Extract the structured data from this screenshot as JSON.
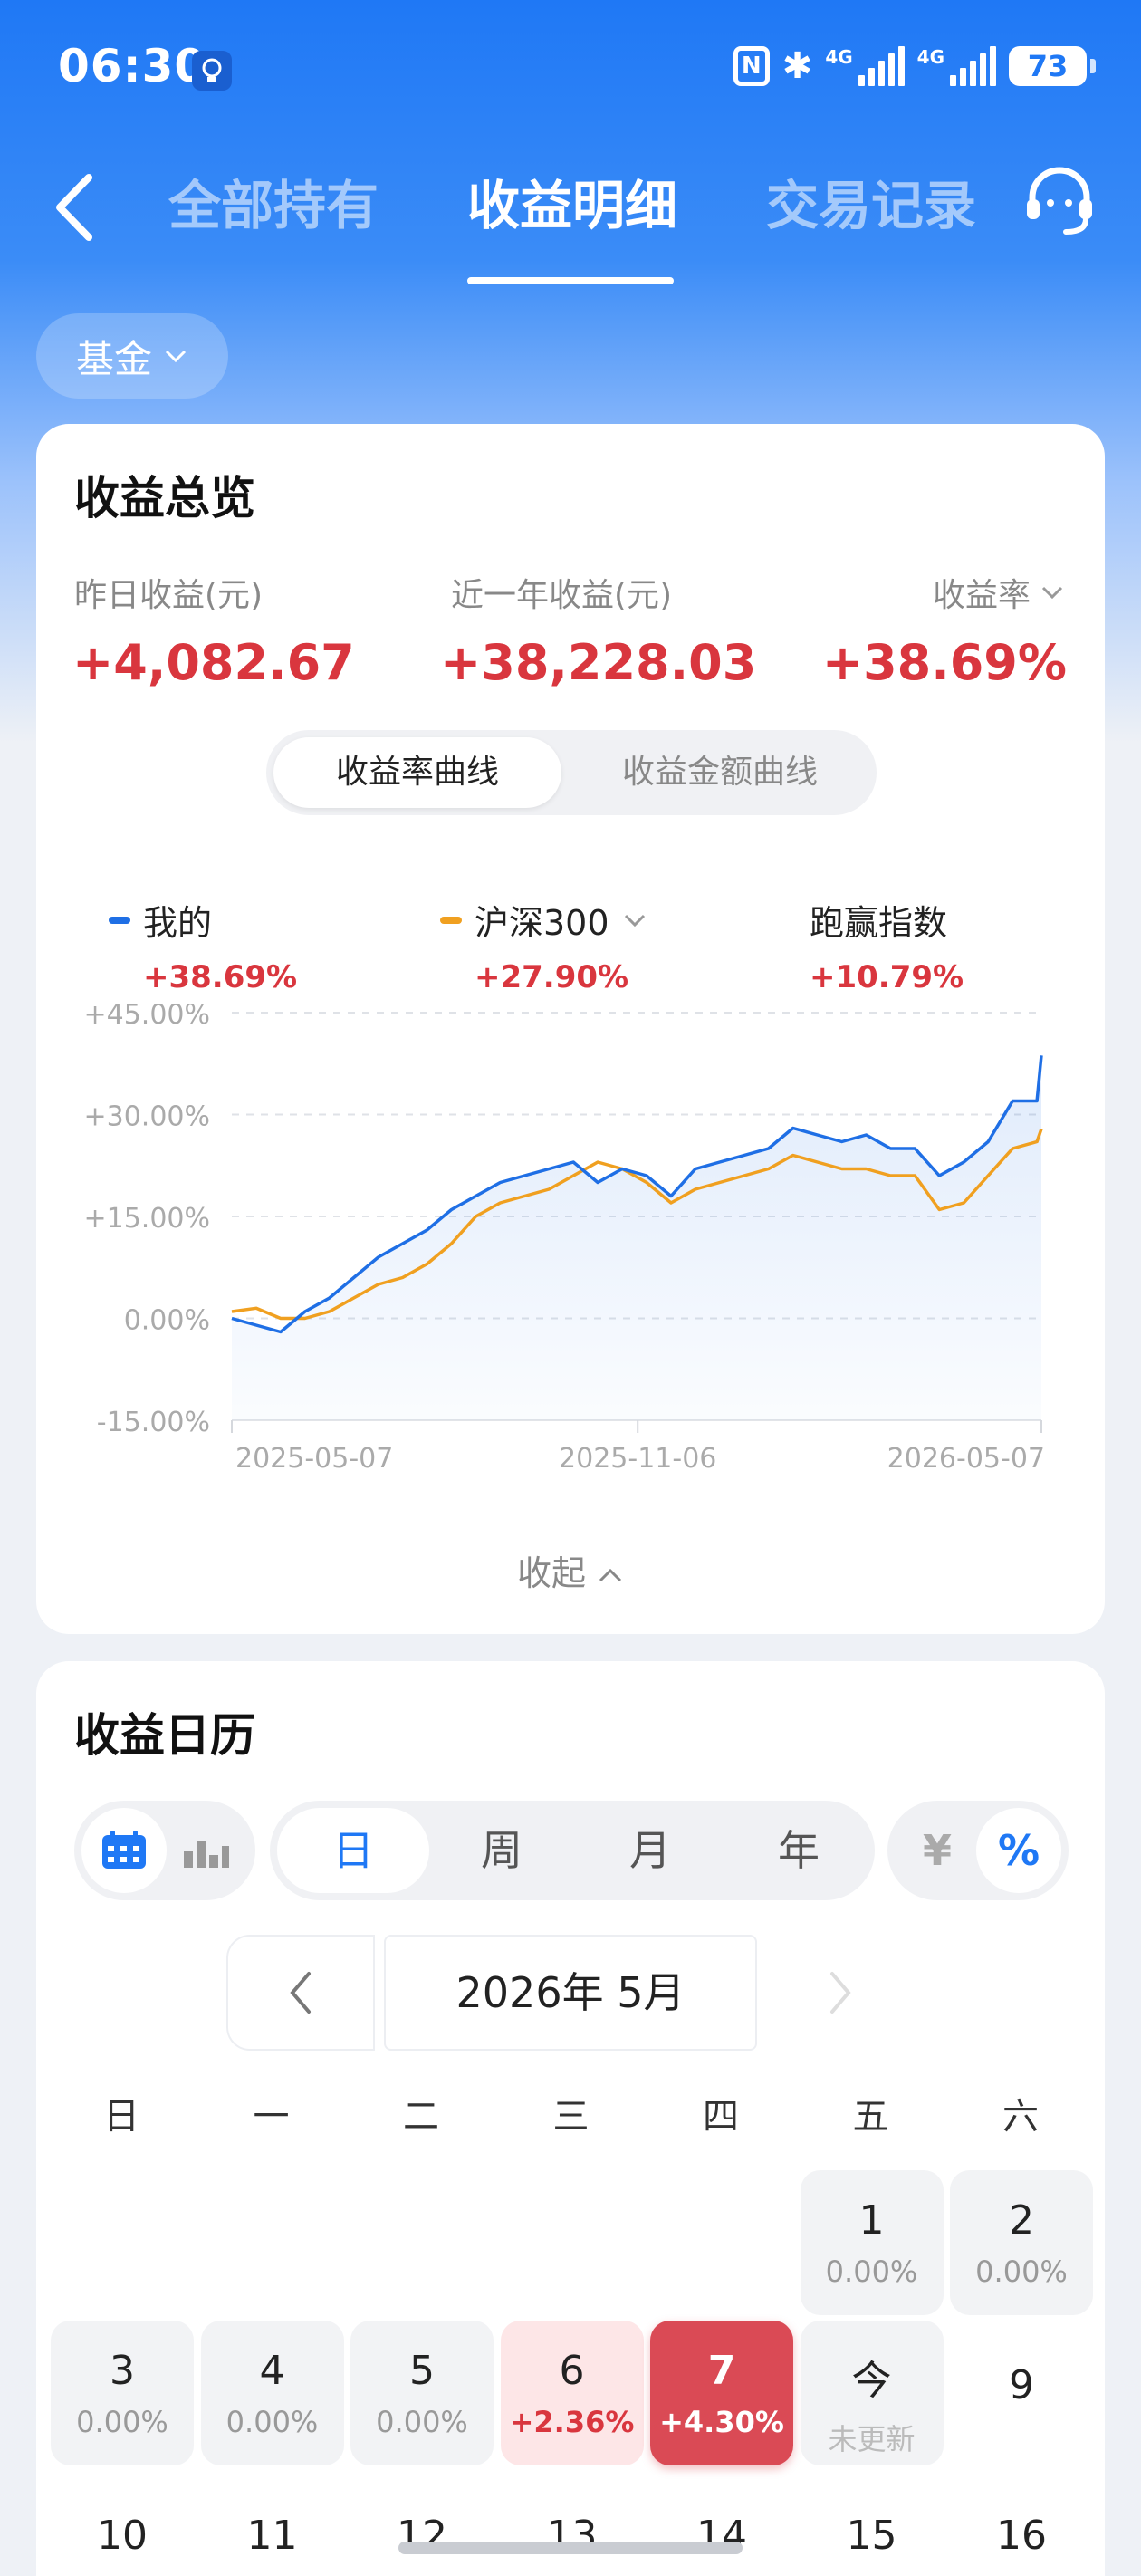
{
  "status_bar": {
    "time": "06:30",
    "battery": "73",
    "net1": "4G",
    "net2": "4G",
    "nfc": "N"
  },
  "nav": {
    "tabs": [
      {
        "label": "全部持有"
      },
      {
        "label": "收益明细"
      },
      {
        "label": "交易记录"
      }
    ]
  },
  "filter": {
    "label": "基金"
  },
  "overview": {
    "title": "收益总览",
    "stats": [
      {
        "label": "昨日收益(元)",
        "value": "+4,082.67"
      },
      {
        "label": "近一年收益(元)",
        "value": "+38,228.03"
      },
      {
        "label": "收益率",
        "value": "+38.69%"
      }
    ],
    "toggle": [
      {
        "label": "收益率曲线"
      },
      {
        "label": "收益金额曲线"
      }
    ],
    "legend": [
      {
        "name": "我的",
        "value": "+38.69%",
        "color": "#1f6fe5"
      },
      {
        "name": "沪深300",
        "value": "+27.90%",
        "color": "#f0a020"
      },
      {
        "name": "跑赢指数",
        "value": "+10.79%"
      }
    ],
    "collapse_label": "收起"
  },
  "chart_data": {
    "type": "line",
    "y_ticks": [
      "+45.00%",
      "+30.00%",
      "+15.00%",
      "0.00%",
      "-15.00%"
    ],
    "ylim": [
      -15,
      45
    ],
    "x_ticks": [
      "2025-05-07",
      "2025-11-06",
      "2026-05-07"
    ],
    "x_tick_dates": [
      "2025-05-07",
      "2025-11-06",
      "2026-05-07"
    ],
    "xlim": [
      "2025-05-07",
      "2026-05-07"
    ],
    "grid": true,
    "series": [
      {
        "name": "我的",
        "color": "#1f6fe5",
        "fill": true,
        "points": [
          [
            "2025-05-07",
            0
          ],
          [
            "2025-05-18",
            -1
          ],
          [
            "2025-05-29",
            -2
          ],
          [
            "2025-06-09",
            1
          ],
          [
            "2025-06-20",
            3
          ],
          [
            "2025-07-01",
            6
          ],
          [
            "2025-07-12",
            9
          ],
          [
            "2025-07-23",
            11
          ],
          [
            "2025-08-03",
            13
          ],
          [
            "2025-08-14",
            16
          ],
          [
            "2025-08-25",
            18
          ],
          [
            "2025-09-05",
            20
          ],
          [
            "2025-09-16",
            21
          ],
          [
            "2025-09-27",
            22
          ],
          [
            "2025-10-08",
            23
          ],
          [
            "2025-10-19",
            20
          ],
          [
            "2025-10-30",
            22
          ],
          [
            "2025-11-10",
            21
          ],
          [
            "2025-11-21",
            18
          ],
          [
            "2025-12-02",
            22
          ],
          [
            "2025-12-13",
            23
          ],
          [
            "2025-12-24",
            24
          ],
          [
            "2026-01-04",
            25
          ],
          [
            "2026-01-15",
            28
          ],
          [
            "2026-01-26",
            27
          ],
          [
            "2026-02-06",
            26
          ],
          [
            "2026-02-17",
            27
          ],
          [
            "2026-02-28",
            25
          ],
          [
            "2026-03-11",
            25
          ],
          [
            "2026-03-22",
            21
          ],
          [
            "2026-04-02",
            23
          ],
          [
            "2026-04-13",
            26
          ],
          [
            "2026-04-24",
            32
          ],
          [
            "2026-05-05",
            32
          ],
          [
            "2026-05-07",
            38.69
          ]
        ]
      },
      {
        "name": "沪深300",
        "color": "#f0a020",
        "fill": false,
        "points": [
          [
            "2025-05-07",
            1
          ],
          [
            "2025-05-18",
            1.5
          ],
          [
            "2025-05-29",
            0
          ],
          [
            "2025-06-09",
            0
          ],
          [
            "2025-06-20",
            1
          ],
          [
            "2025-07-01",
            3
          ],
          [
            "2025-07-12",
            5
          ],
          [
            "2025-07-23",
            6
          ],
          [
            "2025-08-03",
            8
          ],
          [
            "2025-08-14",
            11
          ],
          [
            "2025-08-25",
            15
          ],
          [
            "2025-09-05",
            17
          ],
          [
            "2025-09-16",
            18
          ],
          [
            "2025-09-27",
            19
          ],
          [
            "2025-10-08",
            21
          ],
          [
            "2025-10-19",
            23
          ],
          [
            "2025-10-30",
            22
          ],
          [
            "2025-11-10",
            20
          ],
          [
            "2025-11-21",
            17
          ],
          [
            "2025-12-02",
            19
          ],
          [
            "2025-12-13",
            20
          ],
          [
            "2025-12-24",
            21
          ],
          [
            "2026-01-04",
            22
          ],
          [
            "2026-01-15",
            24
          ],
          [
            "2026-01-26",
            23
          ],
          [
            "2026-02-06",
            22
          ],
          [
            "2026-02-17",
            22
          ],
          [
            "2026-02-28",
            21
          ],
          [
            "2026-03-11",
            21
          ],
          [
            "2026-03-22",
            16
          ],
          [
            "2026-04-02",
            17
          ],
          [
            "2026-04-13",
            21
          ],
          [
            "2026-04-24",
            25
          ],
          [
            "2026-05-05",
            26
          ],
          [
            "2026-05-07",
            27.9
          ]
        ]
      }
    ]
  },
  "calendar": {
    "title": "收益日历",
    "periods": [
      {
        "label": "日"
      },
      {
        "label": "周"
      },
      {
        "label": "月"
      },
      {
        "label": "年"
      }
    ],
    "units": [
      {
        "label": "¥"
      },
      {
        "label": "%"
      }
    ],
    "month_label": "2026年 5月",
    "weekdays": [
      "日",
      "一",
      "二",
      "三",
      "四",
      "五",
      "六"
    ],
    "days": [
      {
        "d": "1",
        "v": "0.00%",
        "col": 5,
        "row": 0,
        "style": "filled"
      },
      {
        "d": "2",
        "v": "0.00%",
        "col": 6,
        "row": 0,
        "style": "filled"
      },
      {
        "d": "3",
        "v": "0.00%",
        "col": 0,
        "row": 1,
        "style": "filled"
      },
      {
        "d": "4",
        "v": "0.00%",
        "col": 1,
        "row": 1,
        "style": "filled"
      },
      {
        "d": "5",
        "v": "0.00%",
        "col": 2,
        "row": 1,
        "style": "filled"
      },
      {
        "d": "6",
        "v": "+2.36%",
        "col": 3,
        "row": 1,
        "style": "pos"
      },
      {
        "d": "7",
        "v": "+4.30%",
        "col": 4,
        "row": 1,
        "style": "hl"
      },
      {
        "d": "今",
        "v": "未更新",
        "col": 5,
        "row": 1,
        "style": "filled today"
      },
      {
        "d": "9",
        "v": "",
        "col": 6,
        "row": 1,
        "style": "plain"
      },
      {
        "d": "10",
        "v": "",
        "col": 0,
        "row": 2,
        "style": "plain"
      },
      {
        "d": "11",
        "v": "",
        "col": 1,
        "row": 2,
        "style": "plain"
      },
      {
        "d": "12",
        "v": "",
        "col": 2,
        "row": 2,
        "style": "plain"
      },
      {
        "d": "13",
        "v": "",
        "col": 3,
        "row": 2,
        "style": "plain"
      },
      {
        "d": "14",
        "v": "",
        "col": 4,
        "row": 2,
        "style": "plain"
      },
      {
        "d": "15",
        "v": "",
        "col": 5,
        "row": 2,
        "style": "plain"
      },
      {
        "d": "16",
        "v": "",
        "col": 6,
        "row": 2,
        "style": "plain"
      }
    ]
  }
}
